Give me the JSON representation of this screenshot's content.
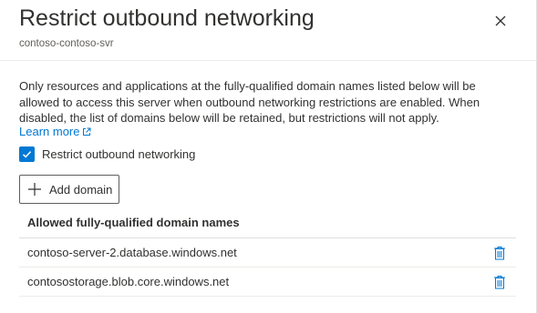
{
  "panel": {
    "title": "Restrict outbound networking",
    "subtitle": "contoso-contoso-svr",
    "close_icon": "close-icon"
  },
  "description": "Only resources and applications at the fully-qualified domain names listed below will be allowed to access this server when outbound networking restrictions are enabled. When disabled, the list of domains below will be retained, but restrictions will not apply.",
  "learn_more": {
    "label": "Learn more",
    "icon": "external-link-icon"
  },
  "checkbox": {
    "label": "Restrict outbound networking",
    "checked": true,
    "icon": "checkmark-icon"
  },
  "add_button": {
    "label": "Add domain",
    "icon": "plus-icon"
  },
  "table": {
    "header": "Allowed fully-qualified domain names",
    "rows": [
      {
        "domain": "contoso-server-2.database.windows.net",
        "action_icon": "trash-icon"
      },
      {
        "domain": "contosostorage.blob.core.windows.net",
        "action_icon": "trash-icon"
      }
    ]
  },
  "colors": {
    "accent": "#0078d4",
    "text": "#323130",
    "secondary_text": "#605e5c"
  }
}
